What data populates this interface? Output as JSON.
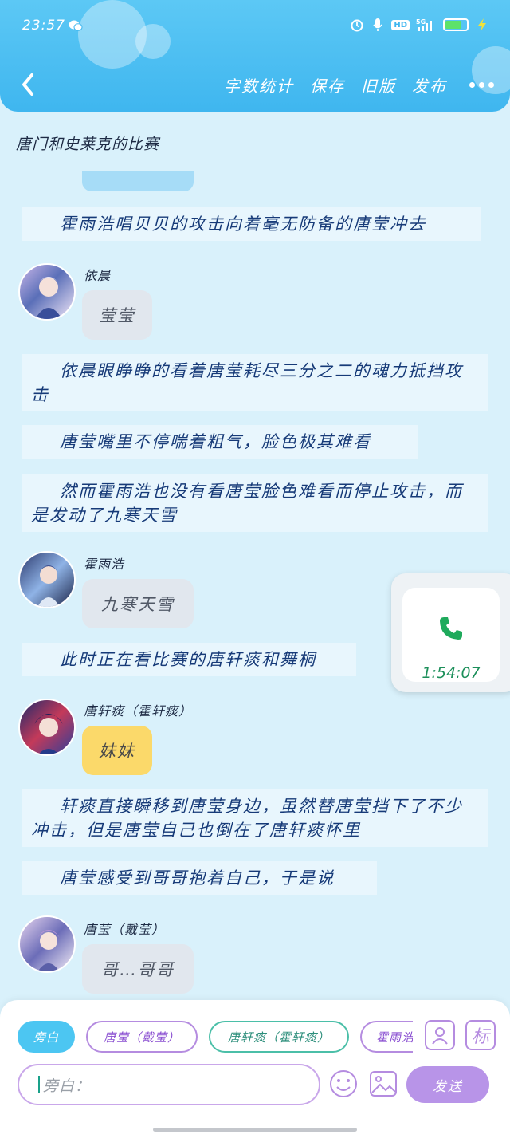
{
  "status_bar": {
    "time": "23:57",
    "network": "5G",
    "hd": "HD"
  },
  "header": {
    "toolbar": [
      "字数统计",
      "保存",
      "旧版",
      "发布"
    ]
  },
  "doc_title": "唐门和史莱克的比赛",
  "messages": [
    {
      "type": "narration",
      "text": "霍雨浩唱贝贝的攻击向着毫无防备的唐莹冲去"
    },
    {
      "type": "speech",
      "speaker": "依晨",
      "text": "莹莹",
      "bubble_color": "#e1e7ee"
    },
    {
      "type": "narration",
      "text": "依晨眼睁睁的看着唐莹耗尽三分之二的魂力抵挡攻击"
    },
    {
      "type": "narration",
      "text": "唐莹嘴里不停喘着粗气，脸色极其难看"
    },
    {
      "type": "narration",
      "text": "然而霍雨浩也没有看唐莹脸色难看而停止攻击，而是发动了九寒天雪"
    },
    {
      "type": "speech",
      "speaker": "霍雨浩",
      "text": "九寒天雪",
      "bubble_color": "#e1e7ee"
    },
    {
      "type": "narration",
      "text": "此时正在看比赛的唐轩痰和舞桐"
    },
    {
      "type": "speech",
      "speaker": "唐轩痰（霍轩痰）",
      "text": "妹妹",
      "bubble_color": "#fbd96a"
    },
    {
      "type": "narration",
      "text": "轩痰直接瞬移到唐莹身边，虽然替唐莹挡下了不少冲击，但是唐莹自己也倒在了唐轩痰怀里"
    },
    {
      "type": "narration",
      "text": "唐莹感受到哥哥抱着自己，于是说"
    },
    {
      "type": "speech",
      "speaker": "唐莹（戴莹）",
      "text": "哥…哥哥",
      "bubble_color": "#e1e7ee"
    }
  ],
  "call_widget": {
    "duration": "1:54:07"
  },
  "input_panel": {
    "roles": [
      {
        "label": "旁白",
        "style": "active"
      },
      {
        "label": "唐莹（戴莹）",
        "style": "purple"
      },
      {
        "label": "唐轩痰（霍轩痰）",
        "style": "teal"
      },
      {
        "label": "霍雨浩",
        "style": "purple"
      }
    ],
    "tag_button": "标",
    "input_placeholder": "旁白：",
    "send_label": "发送"
  },
  "colors": {
    "header": "#3fb6ef",
    "background": "#d9f1fb",
    "accent_purple": "#b894e8",
    "call_green": "#1c8f5a"
  }
}
